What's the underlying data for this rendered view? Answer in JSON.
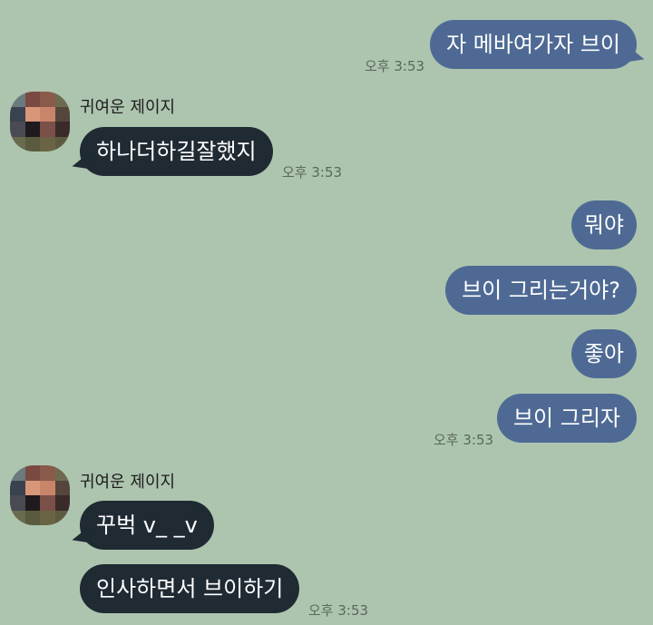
{
  "messages": [
    {
      "text": "자 메바여가자 브이"
    },
    {
      "text": "하나더하길잘했지"
    },
    {
      "text": "뭐야"
    },
    {
      "text": "브이 그리는거야?"
    },
    {
      "text": "좋아"
    },
    {
      "text": "브이 그리자"
    },
    {
      "text": "꾸벅 v_ _v"
    },
    {
      "text": "인사하면서 브이하기"
    }
  ],
  "times": [
    "오후 3:53",
    "오후 3:53",
    "오후 3:53",
    "오후 3:53"
  ],
  "sender_name": "귀여운 제이지",
  "colors": {
    "background": "#adc5ae",
    "my_bubble": "#4e6a94",
    "their_bubble": "#1f2a33"
  }
}
